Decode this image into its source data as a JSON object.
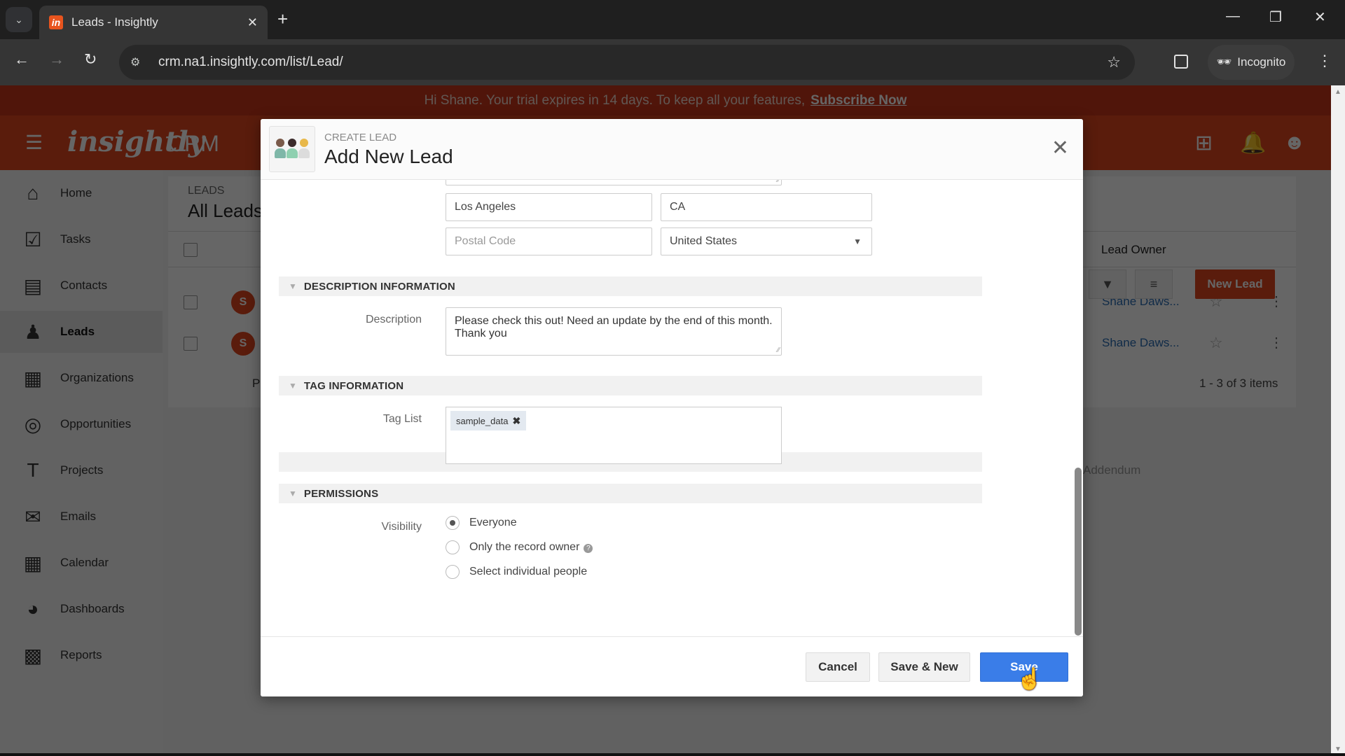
{
  "browser": {
    "tab_title": "Leads - Insightly",
    "tab_favicon": "in",
    "url": "crm.na1.insightly.com/list/Lead/",
    "profile_label": "Incognito",
    "icons": {
      "tab_list": "chevron-down-icon",
      "close_tab": "close-icon",
      "new_tab": "plus-icon",
      "back": "arrow-left-icon",
      "forward": "arrow-right-icon",
      "reload": "reload-icon",
      "site_info": "tune-icon",
      "bookmark": "star-icon",
      "side_panel": "side-panel-icon",
      "menu": "kebab-icon"
    }
  },
  "banner": {
    "text": "Hi Shane. Your trial expires in 14 days. To keep all your features,",
    "link": "Subscribe Now"
  },
  "app_header": {
    "logo": "insightly",
    "product": "CRM"
  },
  "sidebar": {
    "items": [
      {
        "label": "Home",
        "icon": "home-icon"
      },
      {
        "label": "Tasks",
        "icon": "checkbox-icon"
      },
      {
        "label": "Contacts",
        "icon": "contact-card-icon"
      },
      {
        "label": "Leads",
        "icon": "leads-icon",
        "active": true
      },
      {
        "label": "Organizations",
        "icon": "building-icon"
      },
      {
        "label": "Opportunities",
        "icon": "target-icon"
      },
      {
        "label": "Projects",
        "icon": "hammer-icon"
      },
      {
        "label": "Emails",
        "icon": "envelope-icon"
      },
      {
        "label": "Calendar",
        "icon": "calendar-icon"
      },
      {
        "label": "Dashboards",
        "icon": "gauge-icon"
      },
      {
        "label": "Reports",
        "icon": "bar-chart-icon"
      }
    ]
  },
  "list": {
    "breadcrumb": "LEADS",
    "title": "All Leads",
    "new_lead_label": "New Lead",
    "column_owner": "Lead Owner",
    "rows": [
      {
        "avatar": "S",
        "owner": "Shane Daws..."
      },
      {
        "avatar": "S",
        "owner": "Shane Daws..."
      }
    ],
    "pagination": "1 - 3 of 3 items",
    "page_label_fragment": "P",
    "background_text": "Addendum"
  },
  "modal": {
    "kicker": "CREATE LEAD",
    "title": "Add New Lead",
    "address": {
      "city": "Los Angeles",
      "state": "CA",
      "postal_placeholder": "Postal Code",
      "country": "United States"
    },
    "sections": {
      "description": "DESCRIPTION INFORMATION",
      "tags": "TAG INFORMATION",
      "permissions": "PERMISSIONS"
    },
    "description_label": "Description",
    "description_value": "Please check this out! Need an update by the end of this month. Thank you",
    "tag_label": "Tag List",
    "tags": [
      "sample_data"
    ],
    "visibility_label": "Visibility",
    "visibility_options": [
      {
        "label": "Everyone",
        "selected": true
      },
      {
        "label": "Only the record owner",
        "selected": false,
        "help": true
      },
      {
        "label": "Select individual people",
        "selected": false
      }
    ],
    "buttons": {
      "cancel": "Cancel",
      "save_new": "Save & New",
      "save": "Save"
    }
  },
  "colors": {
    "brand": "#e2481f",
    "banner": "#c7361a",
    "primary_button": "#3a7de8",
    "link": "#2a6db5"
  }
}
